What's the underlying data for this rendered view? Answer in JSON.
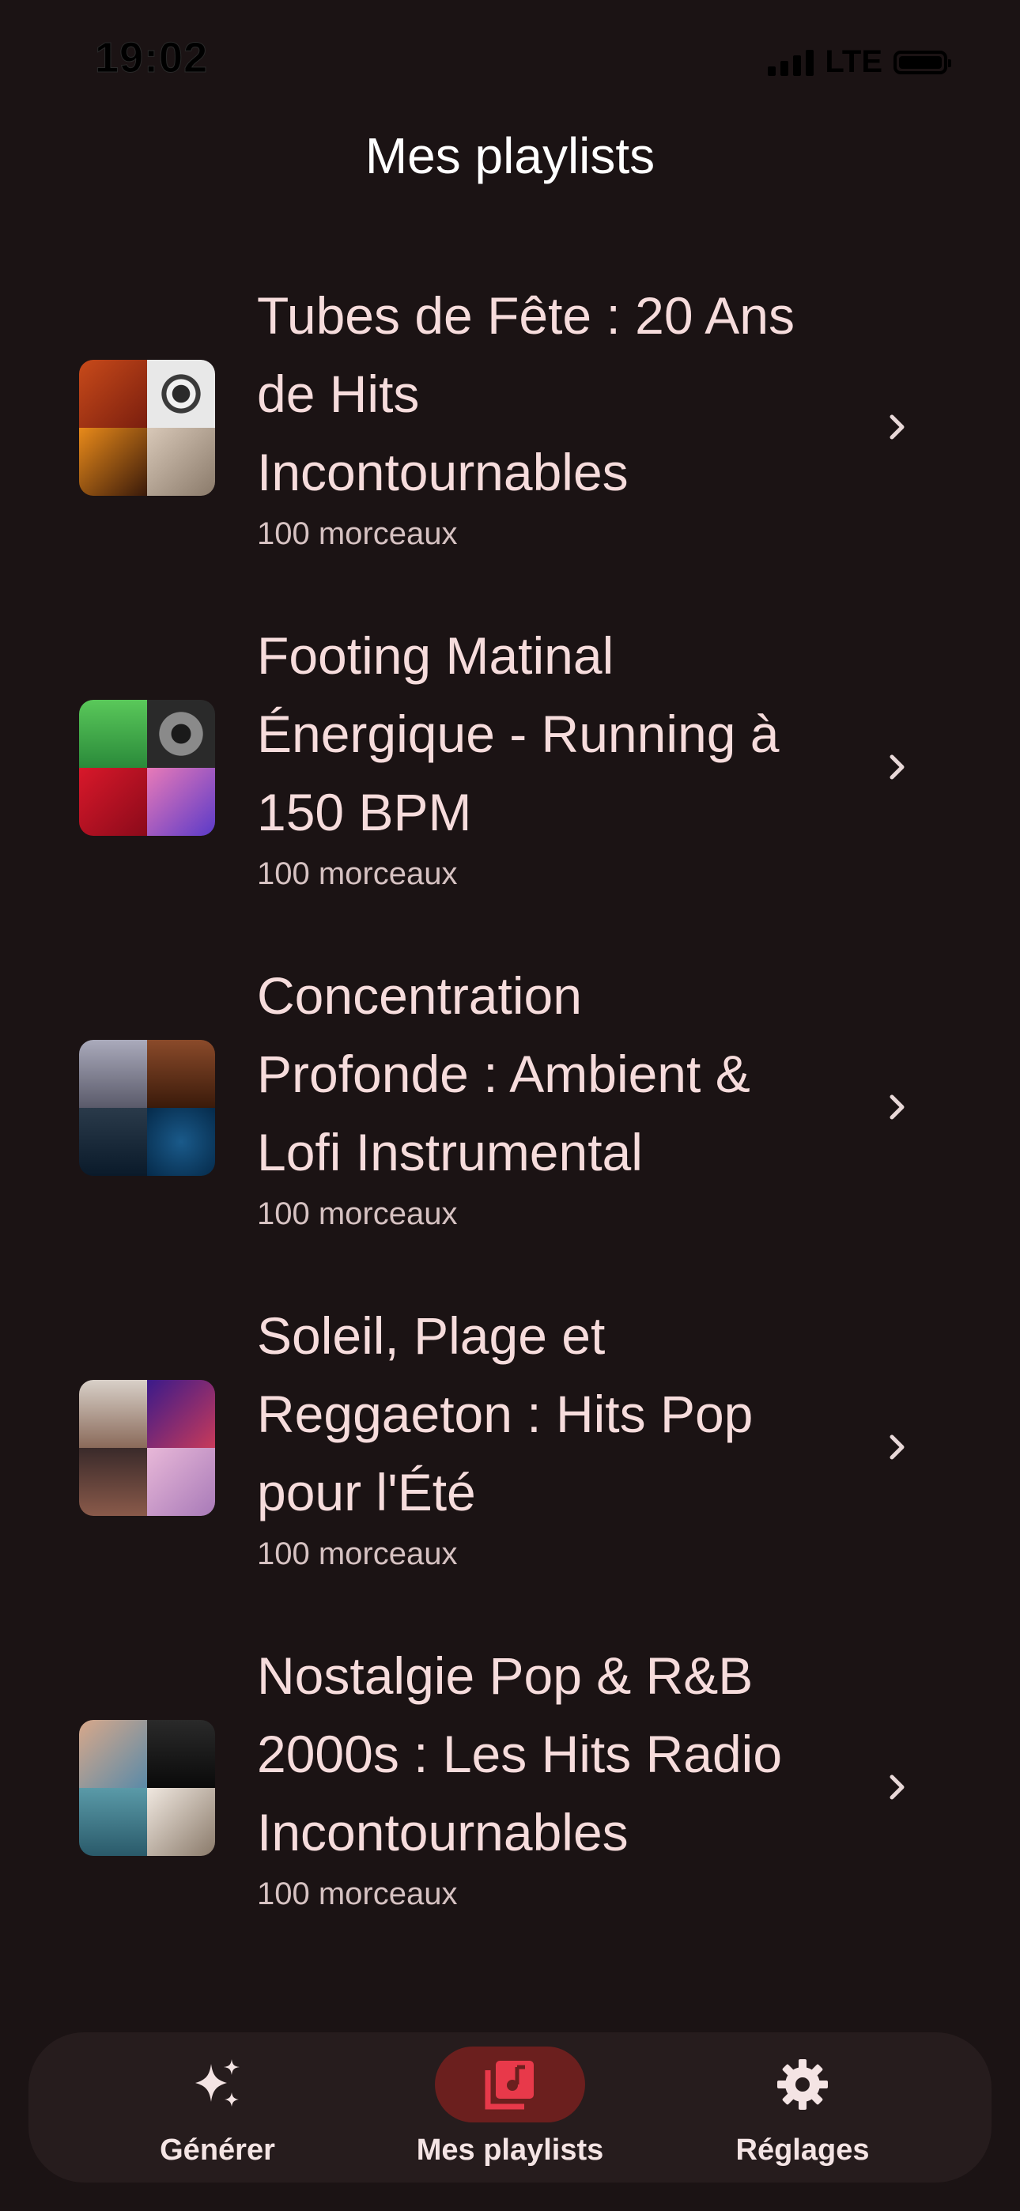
{
  "status_bar": {
    "time": "19:02",
    "network": "LTE"
  },
  "header": {
    "title": "Mes playlists"
  },
  "playlists": [
    {
      "title": "Tubes de Fête : 20 Ans de Hits Incontournables",
      "lines": [
        "Tubes de Fête : 20 Ans",
        "de Hits",
        "Incontournables"
      ],
      "count": "100 morceaux",
      "cover_colors": [
        "#b8401a",
        "#e8e8e8",
        "#2a1c14",
        "#c8b8a8"
      ]
    },
    {
      "title": "Footing Matinal Énergique - Running à 150 BPM",
      "lines": [
        "Footing Matinal",
        "Énergique - Running à",
        "150 BPM"
      ],
      "count": "100 morceaux",
      "cover_colors": [
        "#3aa84a",
        "#2a2a2a",
        "#b8182a",
        "#8a4aa8"
      ]
    },
    {
      "title": "Concentration Profonde : Ambient & Lofi Instrumental",
      "lines": [
        "Concentration",
        "Profonde : Ambient &",
        "Lofi Instrumental"
      ],
      "count": "100 morceaux",
      "cover_colors": [
        "#8a8a9a",
        "#6a3a2a",
        "#1a2a3a",
        "#0a3a5a"
      ]
    },
    {
      "title": "Soleil, Plage et Reggaeton : Hits Pop pour l'Été",
      "lines": [
        "Soleil, Plage et",
        "Reggaeton : Hits Pop",
        "pour l'Été"
      ],
      "count": "100 morceaux",
      "cover_colors": [
        "#c8c0b8",
        "#5a2a8a",
        "#6a4a3a",
        "#c8a8c8"
      ]
    },
    {
      "title": "Nostalgie Pop & R&B 2000s : Les Hits Radio Incontournables",
      "lines": [
        "Nostalgie Pop & R&B",
        "2000s : Les Hits Radio",
        "Incontournables"
      ],
      "count": "100 morceaux",
      "cover_colors": [
        "#c89a7a",
        "#1a1a1a",
        "#6aaab8",
        "#d8d0c8"
      ]
    }
  ],
  "bottom_nav": {
    "items": [
      {
        "label": "Générer",
        "icon": "sparkles-icon",
        "active": false
      },
      {
        "label": "Mes playlists",
        "icon": "library-music-icon",
        "active": true
      },
      {
        "label": "Réglages",
        "icon": "gear-icon",
        "active": false
      }
    ]
  },
  "colors": {
    "background": "#1b1314",
    "nav_background": "#261c1d",
    "active_pill": "#6b1f1e",
    "active_icon": "#e8394a",
    "title_text": "#f6dcdc"
  }
}
